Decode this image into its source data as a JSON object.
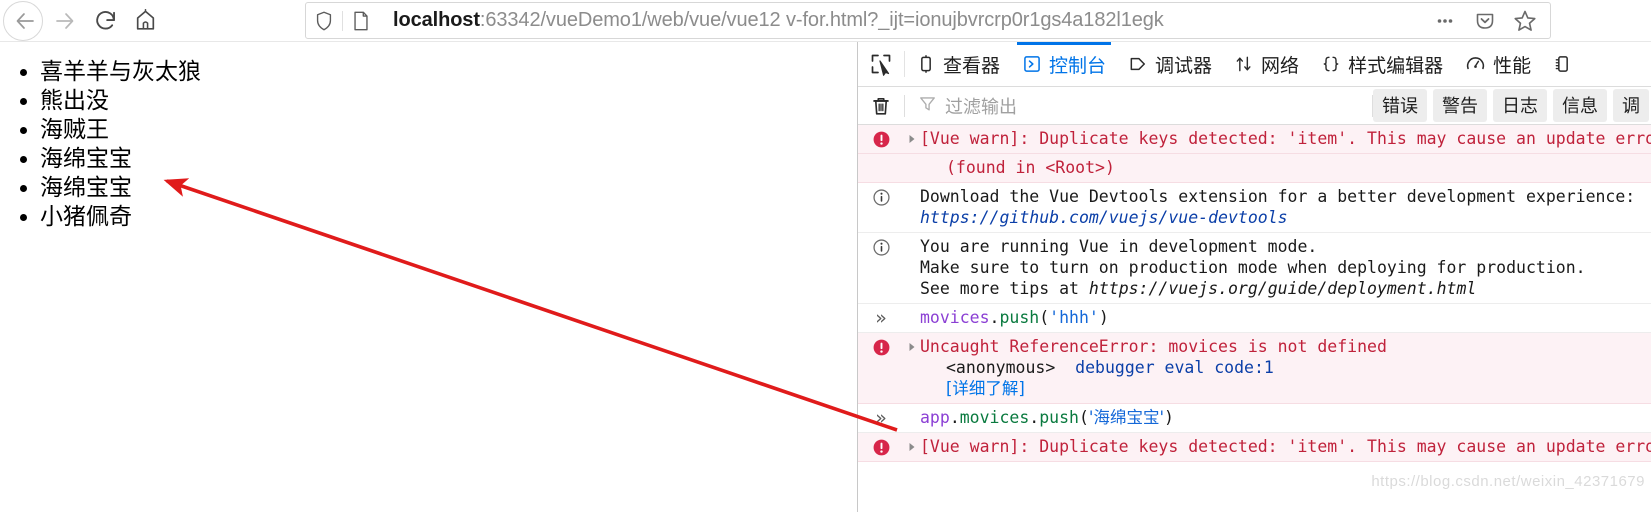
{
  "browser": {
    "nav": {
      "back_label": "Back",
      "forward_label": "Forward",
      "reload_label": "Reload",
      "home_label": "Home"
    },
    "urlbar": {
      "host": "localhost",
      "rest": ":63342/vueDemo1/web/vue/vue12 v-for.html?_ijt=ionujbvrcrp0r1gs4a182l1egk",
      "full_url": "localhost:63342/vueDemo1/web/vue/vue12 v-for.html?_ijt=ionujbvrcrp0r1gs4a182l1egk",
      "shield_icon": "shield-icon",
      "page-icon": "page-icon",
      "more_icon": "ellipsis-icon",
      "pocket_icon": "pocket-icon",
      "bookmark_icon": "star-icon"
    }
  },
  "page": {
    "list_items": [
      "喜羊羊与灰太狼",
      "熊出没",
      "海贼王",
      "海绵宝宝",
      "海绵宝宝",
      "小猪佩奇"
    ]
  },
  "devtools": {
    "picker_icon": "element-picker-icon",
    "tabs": [
      {
        "label": "查看器",
        "icon": "inspector-icon",
        "active": false
      },
      {
        "label": "控制台",
        "icon": "console-icon",
        "active": true
      },
      {
        "label": "调试器",
        "icon": "debugger-icon",
        "active": false
      },
      {
        "label": "网络",
        "icon": "network-icon",
        "active": false
      },
      {
        "label": "样式编辑器",
        "icon": "style-editor-icon",
        "active": false
      },
      {
        "label": "性能",
        "icon": "performance-icon",
        "active": false
      },
      {
        "label": "",
        "icon": "memory-icon",
        "active": false
      }
    ],
    "filterbar": {
      "clear_icon": "trash-icon",
      "filter_icon": "funnel-icon",
      "filter_placeholder": "过滤输出",
      "filter_value": "",
      "buttons": [
        "错误",
        "警告",
        "日志",
        "信息",
        "调"
      ]
    },
    "console_rows": [
      {
        "kind": "error",
        "icon": "error-icon",
        "twisty": true,
        "lines": [
          {
            "text": "[Vue warn]: Duplicate keys detected: 'item'. This may cause an update error",
            "indent": false
          }
        ]
      },
      {
        "kind": "error",
        "icon": "",
        "twisty": false,
        "lines": [
          {
            "text": "(found in <Root>)",
            "indent": true
          }
        ]
      },
      {
        "kind": "info",
        "icon": "info-icon",
        "twisty": false,
        "lines": [
          {
            "text": "Download the Vue Devtools extension for a better development experience:",
            "indent": false
          },
          {
            "text": "https://github.com/vuejs/vue-devtools",
            "indent": false,
            "style": "italic-link"
          }
        ]
      },
      {
        "kind": "info",
        "icon": "info-icon",
        "twisty": false,
        "lines": [
          {
            "text": "You are running Vue in development mode.",
            "indent": false
          },
          {
            "text": "Make sure to turn on production mode when deploying for production.",
            "indent": false
          },
          {
            "text": "See more tips at ",
            "indent": false,
            "suffix_italic": "https://vuejs.org/guide/deployment.html"
          }
        ]
      },
      {
        "kind": "command",
        "icon": "chevron-right-right-icon",
        "tokens": [
          {
            "t": "movices",
            "c": "var"
          },
          {
            "t": ".",
            "c": "pun"
          },
          {
            "t": "push",
            "c": "prop"
          },
          {
            "t": "(",
            "c": "pun"
          },
          {
            "t": "'hhh'",
            "c": "str"
          },
          {
            "t": ")",
            "c": "pun"
          }
        ]
      },
      {
        "kind": "error",
        "icon": "error-icon",
        "twisty": true,
        "lines": [
          {
            "text": "Uncaught ReferenceError: movices is not defined",
            "indent": false
          }
        ],
        "stack": {
          "fn": "<anonymous>",
          "loc": "debugger eval code:1"
        },
        "learn_more": "[详细了解]"
      },
      {
        "kind": "command",
        "icon": "chevron-right-right-icon",
        "tokens": [
          {
            "t": "app",
            "c": "var"
          },
          {
            "t": ".",
            "c": "pun"
          },
          {
            "t": "movices",
            "c": "prop"
          },
          {
            "t": ".",
            "c": "pun"
          },
          {
            "t": "push",
            "c": "prop"
          },
          {
            "t": "(",
            "c": "pun"
          },
          {
            "t": "'海绵宝宝'",
            "c": "str"
          },
          {
            "t": ")",
            "c": "pun"
          }
        ]
      },
      {
        "kind": "error",
        "icon": "error-icon",
        "twisty": true,
        "lines": [
          {
            "text": "[Vue warn]: Duplicate keys detected: 'item'. This may cause an update error",
            "indent": false
          }
        ]
      }
    ],
    "watermark": "https://blog.csdn.net/weixin_42371679"
  }
}
